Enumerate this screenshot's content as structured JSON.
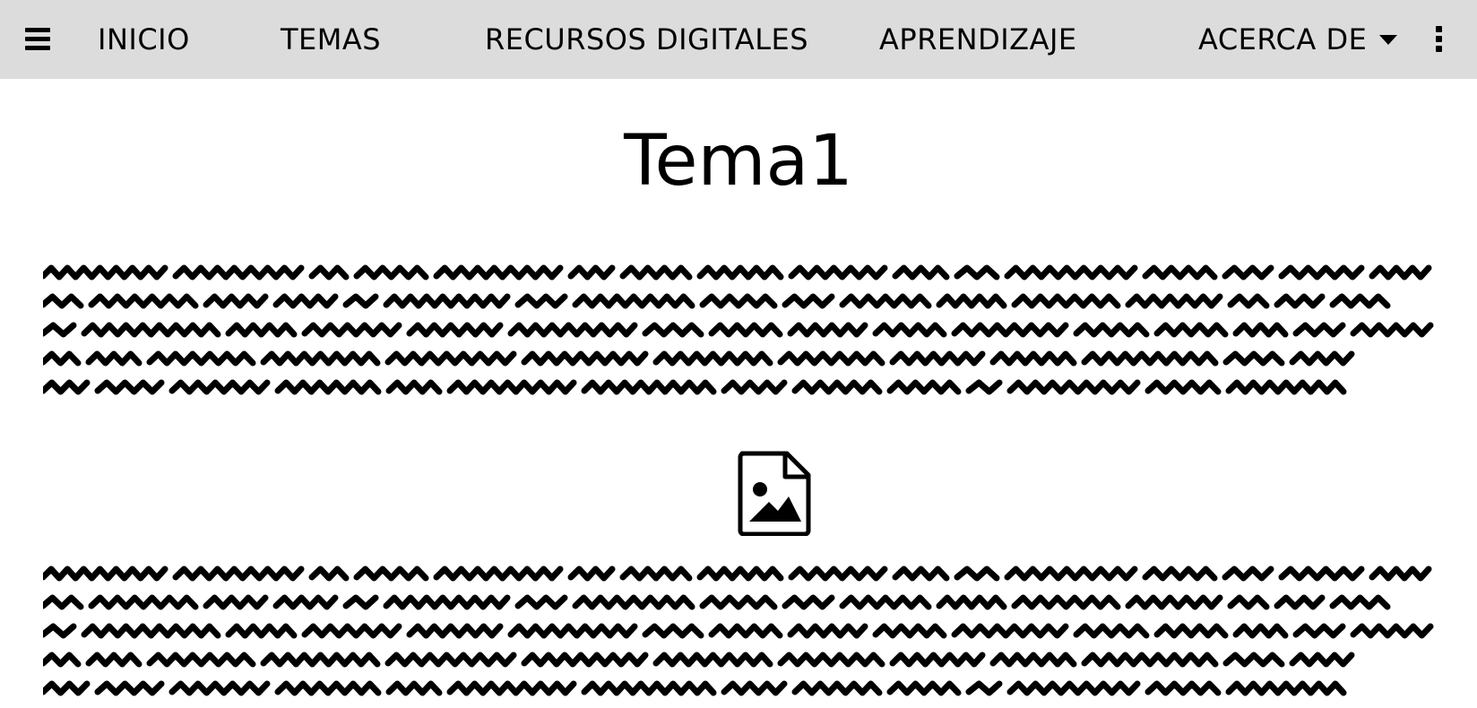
{
  "nav": {
    "menu_icon": "hamburger-menu-icon",
    "items": [
      {
        "label": "INICIO"
      },
      {
        "label": "TEMAS"
      },
      {
        "label": "RECURSOS DIGITALES"
      },
      {
        "label": "APRENDIZAJE"
      },
      {
        "label": "ACERCA DE"
      }
    ],
    "dropdown_icon": "caret-down-icon",
    "more_icon": "vertical-dots-icon"
  },
  "main": {
    "title": "Tema1",
    "image_icon": "image-file-icon"
  },
  "colors": {
    "navbar_bg": "#dcdcdc",
    "page_bg": "#ffffff",
    "text": "#000000"
  }
}
